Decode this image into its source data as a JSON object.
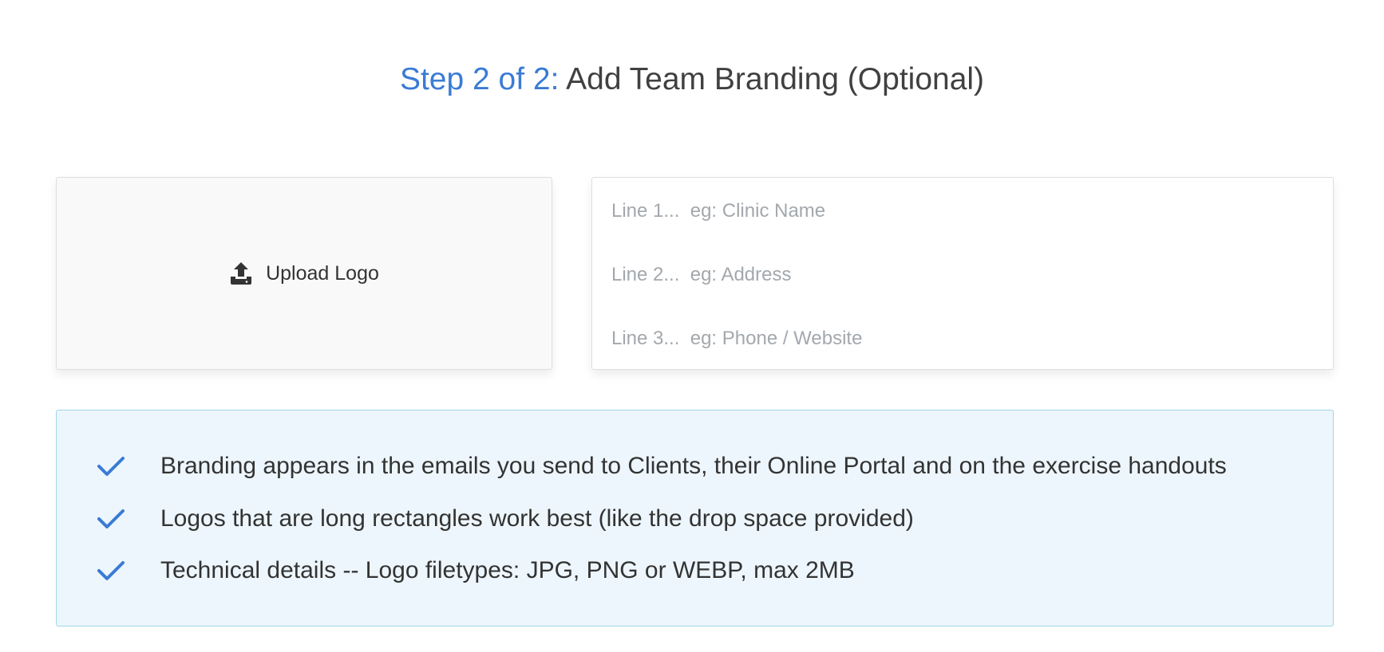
{
  "heading": {
    "step": "Step 2 of 2:",
    "title": "Add Team Branding (Optional)"
  },
  "upload": {
    "label": "Upload Logo",
    "icon": "upload-icon"
  },
  "lines": [
    {
      "placeholder": "Line 1...  eg: Clinic Name"
    },
    {
      "placeholder": "Line 2...  eg: Address"
    },
    {
      "placeholder": "Line 3...  eg: Phone / Website"
    }
  ],
  "info": {
    "items": [
      "Branding appears in the emails you send to Clients, their Online Portal and on the exercise handouts",
      "Logos that are long rectangles work best (like the drop space provided)",
      "Technical details -- Logo filetypes: JPG, PNG or WEBP, max 2MB"
    ],
    "icon": "check-icon"
  },
  "colors": {
    "accent": "#3a7bd5",
    "info_bg": "#edf6fc",
    "info_border": "#9cd8e8",
    "upload_bg": "#f9f9f9"
  }
}
